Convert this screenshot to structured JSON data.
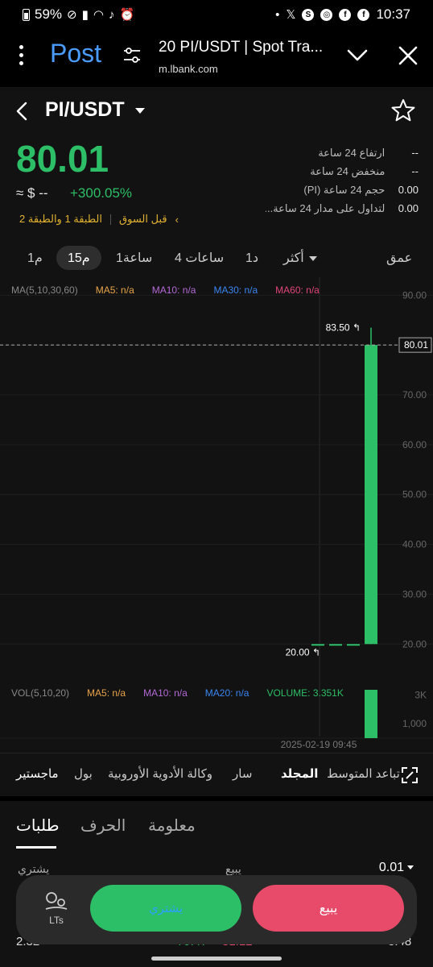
{
  "status_bar": {
    "battery": "59%",
    "time": "10:37",
    "icons_left": [
      "battery-icon",
      "no-disturb-icon",
      "signal-icon",
      "wifi-icon",
      "mute-icon",
      "alarm-icon"
    ],
    "icons_right": [
      "dot-icon",
      "x-icon",
      "s-icon",
      "chrome-icon",
      "facebook-icon",
      "facebook-icon"
    ]
  },
  "browser": {
    "post_label": "Post",
    "title": "20 PI/USDT | Spot Tra...",
    "url": "m.lbank.com"
  },
  "header": {
    "pair": "PI/USDT"
  },
  "ticker": {
    "price": "80.01",
    "fiat": "≈ $ --",
    "change": "+300.05%",
    "tag_premarket": "قبل السوق",
    "tag_tiers": "الطبقة 1 والطبقة 2"
  },
  "stats": [
    {
      "label": "ارتفاع 24 ساعة",
      "value": "--"
    },
    {
      "label": "منخفض 24 ساعة",
      "value": "--"
    },
    {
      "label": "حجم 24 ساعة (PI)",
      "value": "0.00"
    },
    {
      "label": "لتداول على مدار 24 ساعة...",
      "value": "0.00"
    }
  ],
  "intervals": {
    "items": [
      "1م",
      "15م",
      "1ساعة",
      "4 ساعات",
      "1د",
      "أكثر"
    ],
    "active": "15م",
    "depth": "عمق"
  },
  "ma_legend": {
    "name": "MA(5,10,30,60)",
    "ma5": "MA5: n/a",
    "ma10": "MA10: n/a",
    "ma30": "MA30: n/a",
    "ma60": "MA60: n/a"
  },
  "vol_legend": {
    "name": "VOL(5,10,20)",
    "ma5": "MA5: n/a",
    "ma10": "MA10: n/a",
    "ma20": "MA20: n/a",
    "volume": "VOLUME: 3.351K"
  },
  "chart_data": {
    "type": "candlestick",
    "price_axis": [
      "90.00",
      "80.00",
      "70.00",
      "60.00",
      "50.00",
      "40.00",
      "30.00",
      "20.00"
    ],
    "ylim": [
      16,
      92
    ],
    "candles": [
      {
        "open": 20.0,
        "close": 20.0,
        "high": 20.0,
        "low": 20.0
      },
      {
        "open": 20.0,
        "close": 20.0,
        "high": 20.0,
        "low": 20.0
      },
      {
        "open": 20.0,
        "close": 20.0,
        "high": 20.0,
        "low": 20.0
      },
      {
        "open": 20.0,
        "close": 80.01,
        "high": 83.5,
        "low": 20.0
      }
    ],
    "last_price": "80.01",
    "high_label": "83.50",
    "low_label": "20.00",
    "volume_axis": [
      "3K",
      "1,000"
    ],
    "volume_ylim": [
      0,
      3351
    ],
    "volumes": [
      0,
      0,
      0,
      3351
    ],
    "time_label": "2025-02-19 09:45",
    "colors": {
      "up": "#2dbf67",
      "down": "#e84a6a",
      "ma5": "#e8a44a",
      "ma10": "#b46ad6",
      "ma30": "#3b86f0",
      "ma60": "#e0457b",
      "volume": "#2dbf67"
    }
  },
  "indicators": {
    "items": [
      "ماجستير",
      "بول",
      "وكالة الأدوية الأوروبية",
      "سار",
      "المجلد",
      "تباعد المتوسط"
    ],
    "active": "المجلد"
  },
  "tabs": {
    "items": [
      "طلبات",
      "الحرف",
      "معلومة"
    ],
    "active": "طلبات"
  },
  "order_book": {
    "buy_label": "يشتري",
    "sell_label": "يبيع",
    "step": "0.01",
    "row": {
      "left": "2.32",
      "buy": "79.47",
      "sell": "81.12",
      "right": "3.48"
    }
  },
  "actions": {
    "lts": "LTs",
    "buy": "يشتري",
    "sell": "يبيع"
  }
}
